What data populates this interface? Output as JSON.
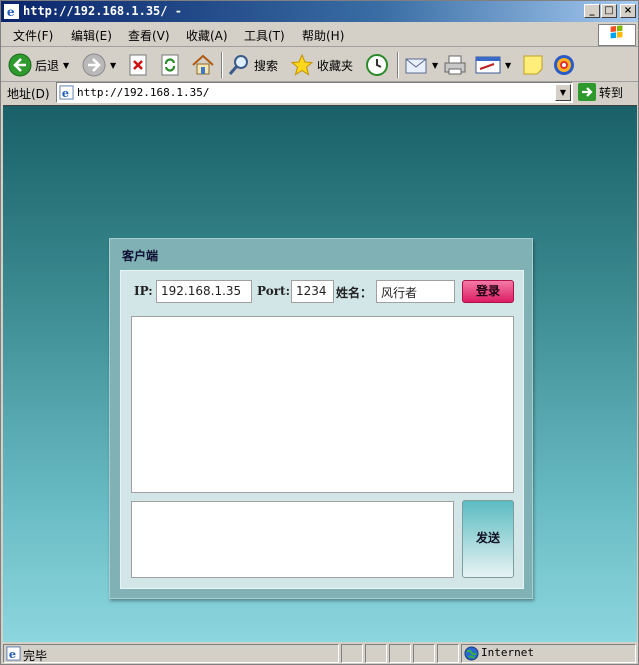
{
  "window": {
    "title": "http://192.168.1.35/ -",
    "controls": {
      "minimize": "_",
      "maximize": "□",
      "close": "×"
    }
  },
  "menu": [
    "文件(F)",
    "编辑(E)",
    "查看(V)",
    "收藏(A)",
    "工具(T)",
    "帮助(H)"
  ],
  "toolbar": {
    "back_label": "后退",
    "search_label": "搜索",
    "favorites_label": "收藏夹"
  },
  "address": {
    "label": "地址(D)",
    "url": "http://192.168.1.35/",
    "go_label": "转到"
  },
  "client": {
    "panel_title": "客户端",
    "ip_label": "IP:",
    "ip_value": "192.168.1.35",
    "port_label": "Port:",
    "port_value": "1234",
    "name_label": "姓名：",
    "name_value": "风行者",
    "login_label": "登录",
    "messages": "",
    "compose": "",
    "send_label": "发送"
  },
  "status": {
    "text": "完毕",
    "zone": "Internet"
  },
  "colors": {
    "titlebar": "#0a246a",
    "background_top": "#1a6068",
    "background_bottom": "#8cd6de",
    "login_button": "#dc1e63",
    "send_button": "#5bbcc2"
  }
}
